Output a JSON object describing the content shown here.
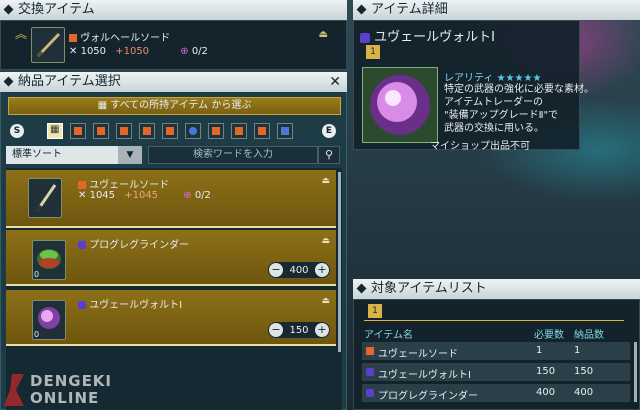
{
  "exchange": {
    "header": "交換アイテム",
    "item_name": "ヴォルヘールソード",
    "power": "1050",
    "bonus": "+1050",
    "slots": "0/2"
  },
  "select": {
    "header": "納品アイテム選択",
    "all_button": "すべての所持アイテム から選ぶ",
    "sort_label": "標準ソート",
    "search_placeholder": "検索ワードを入力",
    "left_key": "S",
    "right_key": "E"
  },
  "candidates": [
    {
      "name": "ユヴェールソード",
      "power": "1045",
      "bonus": "+1045",
      "slots": "0/2"
    },
    {
      "name": "プログレグラインダー",
      "count": "0",
      "qty": "400"
    },
    {
      "name": "ユヴェールヴォルトⅠ",
      "count": "0",
      "qty": "150"
    }
  ],
  "detail": {
    "header": "アイテム詳細",
    "name": "ユヴェールヴォルトⅠ",
    "tab": "1",
    "rarity_label": "レアリティ",
    "stars": "★★★★★",
    "desc1": "特定の武器の強化に必要な素材。",
    "desc2": "アイテムトレーダーの",
    "desc3": "\"装備アップグレードⅡ\"で",
    "desc4": "武器の交換に用いる。",
    "shop": "マイショップ出品不可"
  },
  "targets": {
    "header": "対象アイテムリスト",
    "tab": "1",
    "col_name": "アイテム名",
    "col_req": "必要数",
    "col_del": "納品数",
    "rows": [
      {
        "name": "ユヴェールソード",
        "req": "1",
        "del": "1"
      },
      {
        "name": "ユヴェールヴォルトⅠ",
        "req": "150",
        "del": "150"
      },
      {
        "name": "プログレグラインダー",
        "req": "400",
        "del": "400"
      }
    ]
  },
  "watermark": {
    "top": "DENGEKI",
    "bottom": "ONLINE"
  },
  "colors": {
    "gold": "#8d7018",
    "accent": "#e9dca0",
    "cyan": "#32c8d8"
  }
}
